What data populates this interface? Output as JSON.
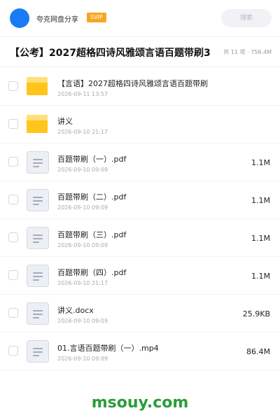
{
  "topbar": {
    "username": "夸克网盘分享",
    "badge": "SVIP",
    "search_placeholder": "搜索"
  },
  "header": {
    "title": "【公考】2027超格四诗风雅颂言语百题带刷3",
    "meta": "共 11 项 · 756.4M"
  },
  "files": [
    {
      "name": "【言语】2027超格四诗风雅颂言语百题带刷",
      "date": "2026-09-11 13:57",
      "size": "",
      "type": "folder"
    },
    {
      "name": "讲义",
      "date": "2026-09-10 21:17",
      "size": "",
      "type": "folder"
    },
    {
      "name": "百题带刷（一）.pdf",
      "date": "2026-09-10 09:09",
      "size": "1.1M",
      "type": "doc"
    },
    {
      "name": "百题带刷（二）.pdf",
      "date": "2026-09-10 09:09",
      "size": "1.1M",
      "type": "doc"
    },
    {
      "name": "百题带刷（三）.pdf",
      "date": "2026-09-10 09:09",
      "size": "1.1M",
      "type": "doc"
    },
    {
      "name": "百题带刷（四）.pdf",
      "date": "2026-09-10 21:17",
      "size": "1.1M",
      "type": "doc"
    },
    {
      "name": "讲义.docx",
      "date": "2026-09-10 09:09",
      "size": "25.9KB",
      "type": "doc"
    },
    {
      "name": "01.言语百题带刷（一）.mp4",
      "date": "2026-09-10 09:09",
      "size": "86.4M",
      "type": "doc"
    }
  ],
  "watermark": "msouy.com",
  "colors": {
    "accent": "#1a7cf5",
    "svip": "#f6a623",
    "folder": "#ffc51a",
    "watermark": "#2a9d3a"
  }
}
